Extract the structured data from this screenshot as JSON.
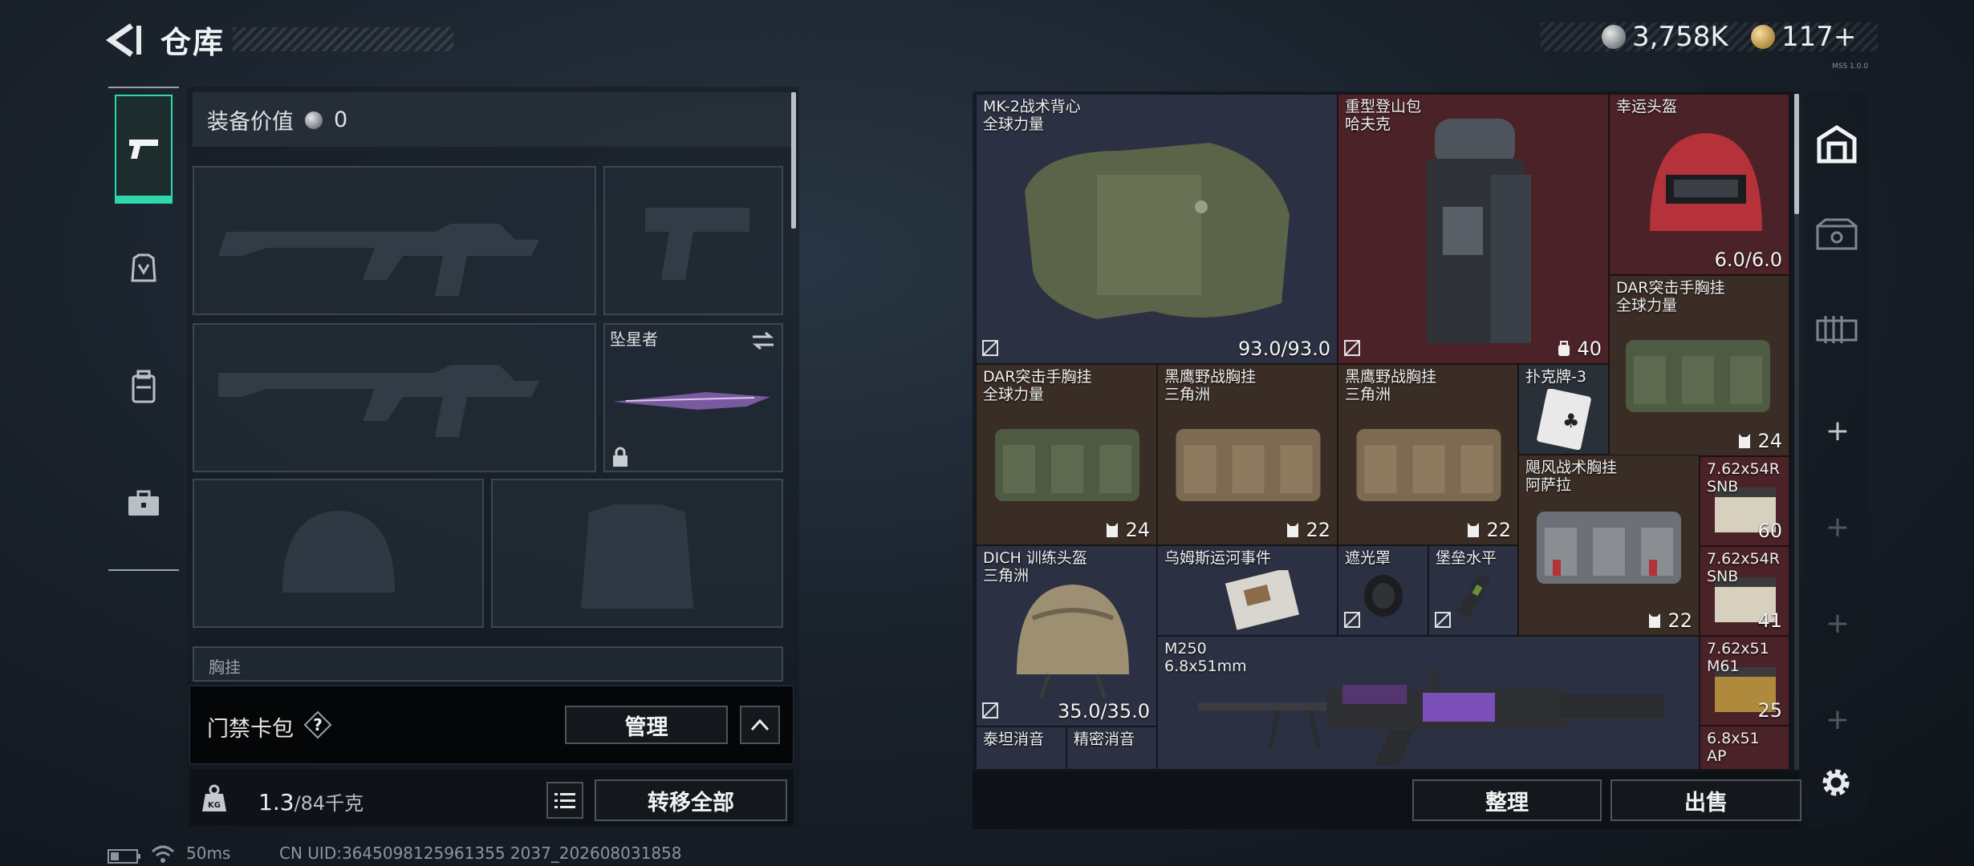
{
  "header": {
    "title": "仓库"
  },
  "currency": {
    "silver": "3,758K",
    "gold": "117+",
    "version": "MSS 1.0.0"
  },
  "equipment": {
    "value_label": "装备价值",
    "value": "0",
    "melee_name": "坠星者",
    "chest_rig_label": "胸挂"
  },
  "card_pack": {
    "label": "门禁卡包",
    "help": "?",
    "manage": "管理"
  },
  "weight": {
    "current": "1.3",
    "max": "/84千克",
    "transfer_all": "转移全部"
  },
  "stash": {
    "items": [
      {
        "name": "MK-2战术背心\n全球力量",
        "value": "93.0/93.0",
        "bg": "#2b3142"
      },
      {
        "name": "重型登山包\n哈夫克",
        "value": "40",
        "bg": "#4a2227"
      },
      {
        "name": "幸运头盔",
        "value": "6.0/6.0",
        "bg": "#4a2227"
      },
      {
        "name": "DAR突击手胸挂\n全球力量",
        "value": "24",
        "bg": "#3a2d25"
      },
      {
        "name": "DAR突击手胸挂\n全球力量",
        "value": "24",
        "bg": "#3a2d25"
      },
      {
        "name": "黑鹰野战胸挂\n三角洲",
        "value": "22",
        "bg": "#3a2d25"
      },
      {
        "name": "黑鹰野战胸挂\n三角洲",
        "value": "22",
        "bg": "#3a2d25"
      },
      {
        "name": "扑克牌-3",
        "value": "",
        "bg": "#3a2d25"
      },
      {
        "name": "飓风战术胸挂\n阿萨拉",
        "value": "22",
        "bg": "#3a2d25"
      },
      {
        "name": "7.62x54R\nSNB",
        "value": "60",
        "bg": "#4a2227"
      },
      {
        "name": "7.62x54R\nSNB",
        "value": "41",
        "bg": "#4a2227"
      },
      {
        "name": "7.62x51\nM61",
        "value": "25",
        "bg": "#4a2227"
      },
      {
        "name": "6.8x51\nAP",
        "value": "",
        "bg": "#4a2227"
      },
      {
        "name": "DICH 训练头盔\n三角洲",
        "value": "35.0/35.0",
        "bg": "#2b3142"
      },
      {
        "name": "乌姆斯运河事件",
        "value": "",
        "bg": "#2b3142"
      },
      {
        "name": "遮光罩",
        "value": "",
        "bg": "#2b3142"
      },
      {
        "name": "堡垒水平",
        "value": "",
        "bg": "#2b3142"
      },
      {
        "name": "M250\n6.8x51mm",
        "value": "",
        "bg": "#2b3142"
      },
      {
        "name": "泰坦消音",
        "value": "",
        "bg": "#2b3142"
      },
      {
        "name": "精密消音",
        "value": "",
        "bg": "#2b3142"
      }
    ],
    "sort": "整理",
    "sell": "出售"
  },
  "status_bar": {
    "ping": "50ms",
    "uid": "CN UID:3645098125961355 2037_202608031858"
  },
  "colors": {
    "accent": "#2fd8a8",
    "rare_red": "#4a2227",
    "epic_blue": "#2b3142",
    "brown": "#3a2d25"
  }
}
